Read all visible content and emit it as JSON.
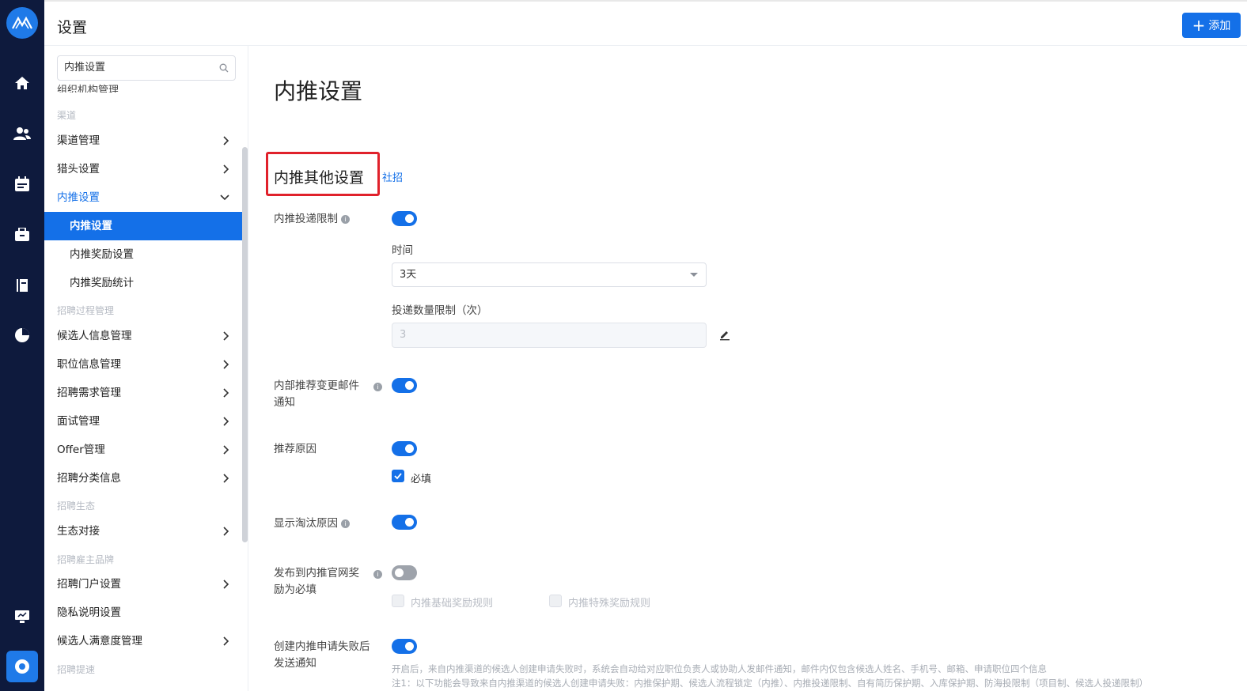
{
  "app": {
    "title": "设置",
    "add_button": "添加",
    "logo_icon": "app-logo-icon"
  },
  "rail": {
    "icons": [
      "home-icon",
      "users-icon",
      "calendar-icon",
      "briefcase-icon",
      "book-icon",
      "pie-chart-icon",
      "monitor-icon",
      "settings-icon"
    ]
  },
  "sidebar": {
    "search_value": "内推设置",
    "partial_item": "组织机构管理",
    "group_channel": "渠道",
    "channel_mgmt": "渠道管理",
    "headhunter": "猎头设置",
    "referral": "内推设置",
    "sub_referral_settings": "内推设置",
    "sub_reward_settings": "内推奖励设置",
    "sub_reward_stats": "内推奖励统计",
    "group_process": "招聘过程管理",
    "candidate_info": "候选人信息管理",
    "position_info": "职位信息管理",
    "demand_mgmt": "招聘需求管理",
    "interview_mgmt": "面试管理",
    "offer_mgmt": "Offer管理",
    "category_info": "招聘分类信息",
    "group_ecosystem": "招聘生态",
    "eco_connect": "生态对接",
    "group_brand": "招聘雇主品牌",
    "portal_settings": "招聘门户设置",
    "privacy": "隐私说明设置",
    "satisfaction": "候选人满意度管理",
    "group_efficiency": "招聘提速"
  },
  "main": {
    "page_title": "内推设置",
    "section_title": "内推其他设置",
    "section_tag": "社招",
    "limit_label": "内推投递限制",
    "time_label": "时间",
    "time_value": "3天",
    "count_label": "投递数量限制（次）",
    "count_value": "3",
    "email_label_1": "内部推荐变更邮件",
    "email_label_2": "通知",
    "reason_label": "推荐原因",
    "required_label": "必填",
    "eliminate_label": "显示淘汰原因",
    "publish_label_1": "发布到内推官网奖",
    "publish_label_2": "励为必填",
    "basic_rule": "内推基础奖励规则",
    "special_rule": "内推特殊奖励规则",
    "fail_label_1": "创建内推申请失败后",
    "fail_label_2": "发送通知",
    "note_1": "开启后，来自内推渠道的候选人创建申请失败时，系统会自动给对应职位负责人或协助人发邮件通知，邮件内仅包含候选人姓名、手机号、邮箱、申请职位四个信息",
    "note_2": "注1：以下功能会导致来自内推渠道的候选人创建申请失败：内推保护期、候选人流程锁定（内推）、内推投递限制、自有简历保护期、入库保护期、防海投限制（项目制、候选人投递限制）"
  },
  "toggles": {
    "limit": true,
    "email": true,
    "reason": true,
    "eliminate": true,
    "publish": false,
    "fail_notify": true,
    "required_checked": true,
    "basic_rule_checked": false,
    "special_rule_checked": false
  },
  "colors": {
    "accent": "#1470e8",
    "rail_bg": "#0e1a3d",
    "highlight_box": "#e0212b"
  }
}
